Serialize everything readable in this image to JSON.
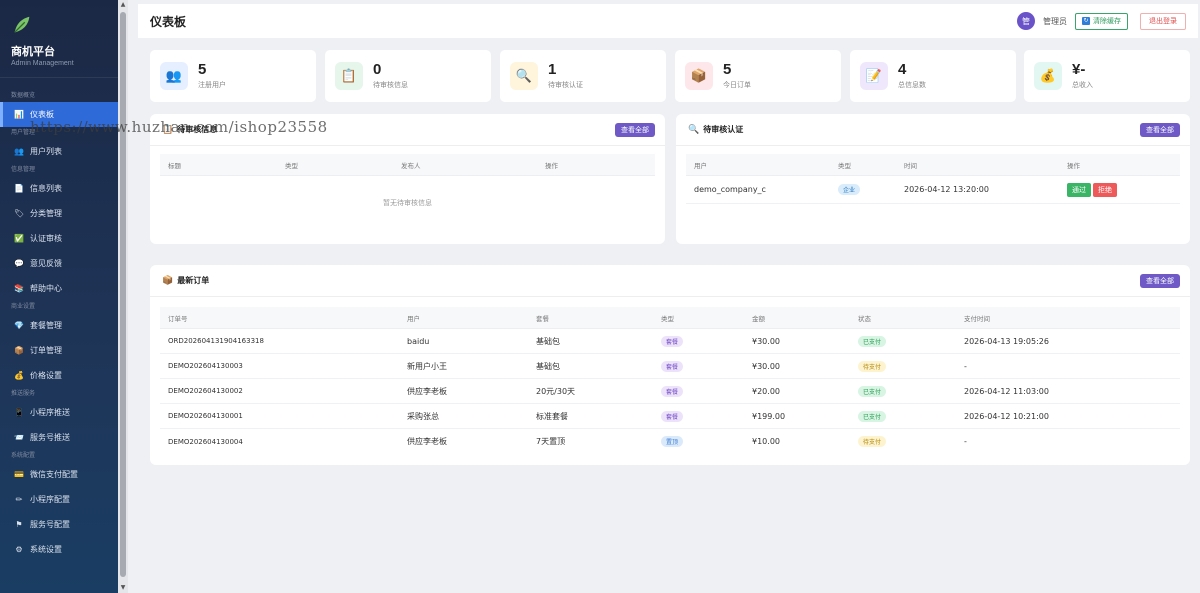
{
  "sidebar": {
    "brand": "商机平台",
    "brand_sub": "Admin Management",
    "sections": {
      "overview": "数据概览",
      "users": "用户管理",
      "info": "信息管理",
      "business": "商业设置",
      "push": "推送服务",
      "system": "系统配置"
    },
    "items": [
      {
        "label": "仪表板",
        "icon": "chart-icon"
      },
      {
        "label": "用户列表",
        "icon": "users-icon"
      },
      {
        "label": "信息列表",
        "icon": "document-icon"
      },
      {
        "label": "分类管理",
        "icon": "tag-icon"
      },
      {
        "label": "认证审核",
        "icon": "check-icon"
      },
      {
        "label": "意见反馈",
        "icon": "feedback-icon"
      },
      {
        "label": "帮助中心",
        "icon": "book-icon"
      },
      {
        "label": "套餐管理",
        "icon": "diamond-icon"
      },
      {
        "label": "订单管理",
        "icon": "box-icon"
      },
      {
        "label": "价格设置",
        "icon": "money-bag-icon"
      },
      {
        "label": "小程序推送",
        "icon": "phone-icon"
      },
      {
        "label": "服务号推送",
        "icon": "message-icon"
      },
      {
        "label": "微信支付配置",
        "icon": "card-icon"
      },
      {
        "label": "小程序配置",
        "icon": "pen-icon"
      },
      {
        "label": "服务号配置",
        "icon": "flag-icon"
      },
      {
        "label": "系统设置",
        "icon": "gear-icon"
      }
    ]
  },
  "topbar": {
    "title": "仪表板",
    "avatar_text": "管",
    "admin_name": "管理员",
    "clear_cache": "清除缓存",
    "logout": "退出登录"
  },
  "stats": [
    {
      "value": "5",
      "label": "注册用户",
      "icon": "users-icon",
      "bg": "#e6efff"
    },
    {
      "value": "0",
      "label": "待审核信息",
      "icon": "clipboard-icon",
      "bg": "#e6f6ea"
    },
    {
      "value": "1",
      "label": "待审核认证",
      "icon": "magnifier-icon",
      "bg": "#fff4dc"
    },
    {
      "value": "5",
      "label": "今日订单",
      "icon": "box-icon",
      "bg": "#fde7ea"
    },
    {
      "value": "4",
      "label": "总信息数",
      "icon": "memo-icon",
      "bg": "#efe7fb"
    },
    {
      "value": "¥-",
      "label": "总收入",
      "icon": "money-bag-icon",
      "bg": "#e3f7f2"
    }
  ],
  "pending_info": {
    "title": "待审核信息",
    "view_all": "查看全部",
    "columns": [
      "标题",
      "类型",
      "发布人",
      "操作"
    ],
    "empty": "暂无待审核信息"
  },
  "pending_auth": {
    "title": "待审核认证",
    "view_all": "查看全部",
    "columns": [
      "用户",
      "类型",
      "时间",
      "操作"
    ],
    "rows": [
      {
        "user": "demo_company_c",
        "type": "企业",
        "time": "2026-04-12 13:20:00",
        "pass": "通过",
        "reject": "拒绝"
      }
    ]
  },
  "orders": {
    "title": "最新订单",
    "view_all": "查看全部",
    "columns": [
      "订单号",
      "用户",
      "套餐",
      "类型",
      "金额",
      "状态",
      "支付时间"
    ],
    "rows": [
      {
        "id": "ORD202604131904163318",
        "user": "baidu",
        "plan": "基础包",
        "type": "套餐",
        "amount": "¥30.00",
        "status": "已支付",
        "paid_at": "2026-04-13 19:05:26"
      },
      {
        "id": "DEMO202604130003",
        "user": "新用户小王",
        "plan": "基础包",
        "type": "套餐",
        "amount": "¥30.00",
        "status": "待支付",
        "paid_at": "-"
      },
      {
        "id": "DEMO202604130002",
        "user": "供应李老板",
        "plan": "20元/30天",
        "type": "套餐",
        "amount": "¥20.00",
        "status": "已支付",
        "paid_at": "2026-04-12 11:03:00"
      },
      {
        "id": "DEMO202604130001",
        "user": "采购张总",
        "plan": "标准套餐",
        "type": "套餐",
        "amount": "¥199.00",
        "status": "已支付",
        "paid_at": "2026-04-12 10:21:00"
      },
      {
        "id": "DEMO202604130004",
        "user": "供应李老板",
        "plan": "7天置顶",
        "type": "置顶",
        "amount": "¥10.00",
        "status": "待支付",
        "paid_at": "-"
      }
    ]
  },
  "watermark": "https://www.huzhan.com/ishop23558"
}
